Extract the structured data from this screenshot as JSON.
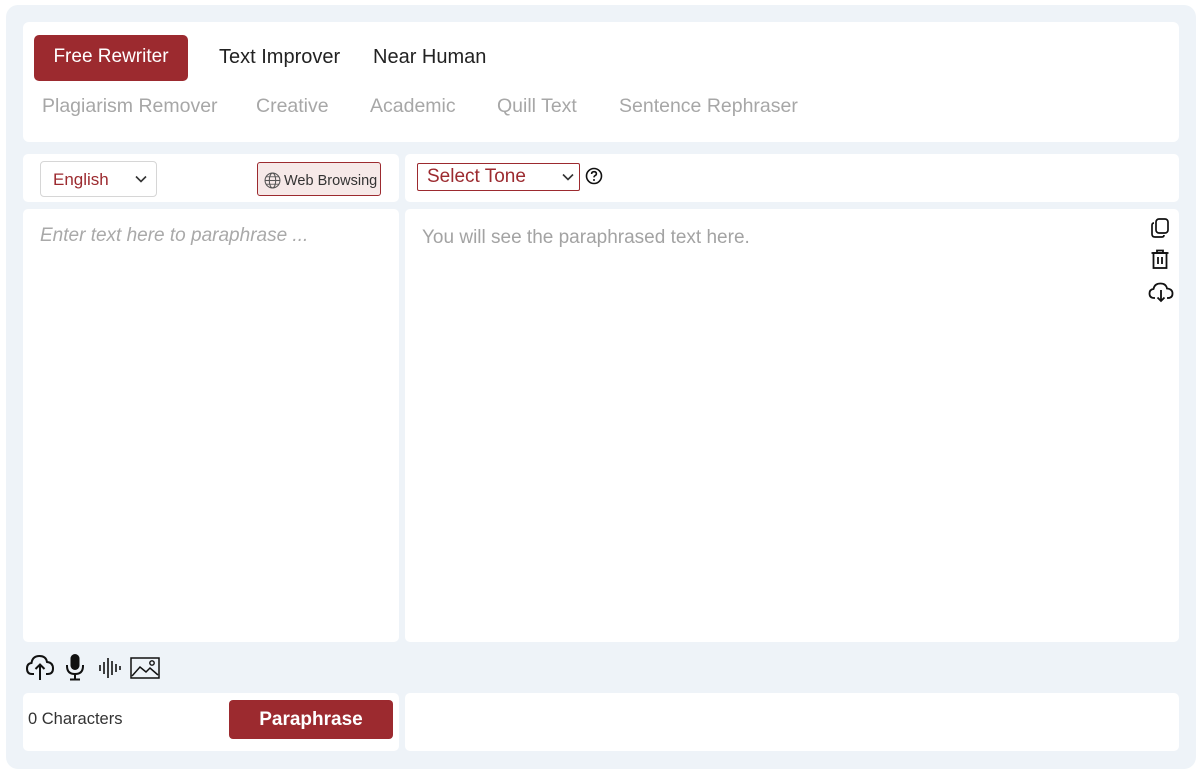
{
  "modes": {
    "row1": [
      {
        "label": "Free Rewriter",
        "active": true
      },
      {
        "label": "Text Improver",
        "active": false
      },
      {
        "label": "Near Human",
        "active": false
      }
    ],
    "row2": [
      {
        "label": "Plagiarism Remover"
      },
      {
        "label": "Creative"
      },
      {
        "label": "Academic"
      },
      {
        "label": "Quill Text"
      },
      {
        "label": "Sentence Rephraser"
      }
    ]
  },
  "input_panel": {
    "language": "English",
    "web_browsing_label": "Web Browsing",
    "placeholder": "Enter text here to paraphrase ...",
    "char_count": "0 Characters",
    "paraphrase_label": "Paraphrase",
    "tools": [
      "upload-cloud-icon",
      "microphone-icon",
      "audio-wave-icon",
      "image-icon"
    ]
  },
  "output_panel": {
    "tone_label": "Select Tone",
    "placeholder": "You will see the paraphrased text here.",
    "actions": [
      "copy-icon",
      "trash-icon",
      "download-cloud-icon"
    ]
  },
  "colors": {
    "accent": "#9c2a2f",
    "background": "#eef3f8",
    "muted_text": "#a7a7a7"
  }
}
